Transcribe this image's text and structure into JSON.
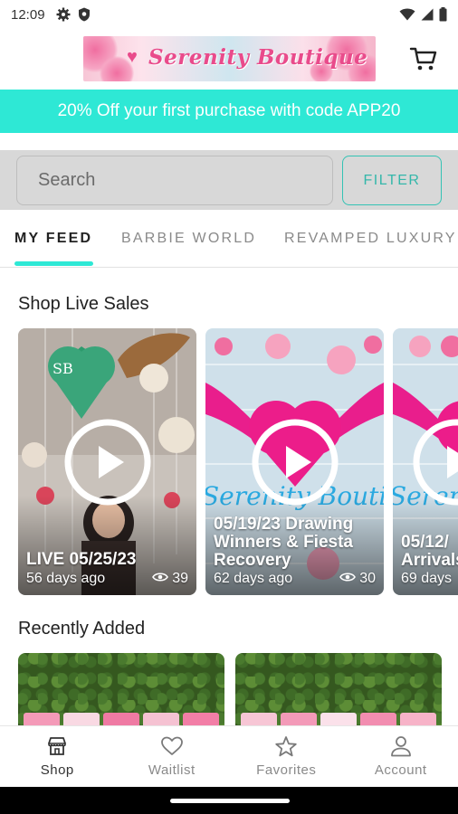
{
  "status_bar": {
    "time": "12:09",
    "left_icons": [
      "gear-icon",
      "shield-icon"
    ],
    "right_icons": [
      "wifi-icon",
      "signal-icon",
      "battery-icon"
    ]
  },
  "header": {
    "logo_text": "Serenity Boutique",
    "cart_icon": "cart-icon"
  },
  "promo": {
    "text": "20% Off your first purchase with code APP20",
    "background": "#2ee8d5"
  },
  "search": {
    "placeholder": "Search",
    "filter_label": "FILTER"
  },
  "tabs": [
    {
      "label": "MY FEED",
      "active": true
    },
    {
      "label": "BARBIE WORLD",
      "active": false
    },
    {
      "label": "REVAMPED LUXURY",
      "active": false
    }
  ],
  "live_sales": {
    "title": "Shop Live Sales",
    "cards": [
      {
        "title": "LIVE 05/25/23",
        "age": "56 days ago",
        "views": "39"
      },
      {
        "title": "05/19/23 Drawing Winners & Fiesta Recovery",
        "age": "62 days ago",
        "views": "30"
      },
      {
        "title": "05/12/ Arrivals",
        "age": "69 days",
        "views": ""
      }
    ]
  },
  "recently_added": {
    "title": "Recently Added"
  },
  "bottom_nav": [
    {
      "label": "Shop",
      "icon": "shop-icon",
      "active": true
    },
    {
      "label": "Waitlist",
      "icon": "heart-icon",
      "active": false
    },
    {
      "label": "Favorites",
      "icon": "star-icon",
      "active": false
    },
    {
      "label": "Account",
      "icon": "account-icon",
      "active": false
    }
  ],
  "colors": {
    "accent": "#2ee8d5",
    "filter": "#34b7aa"
  }
}
